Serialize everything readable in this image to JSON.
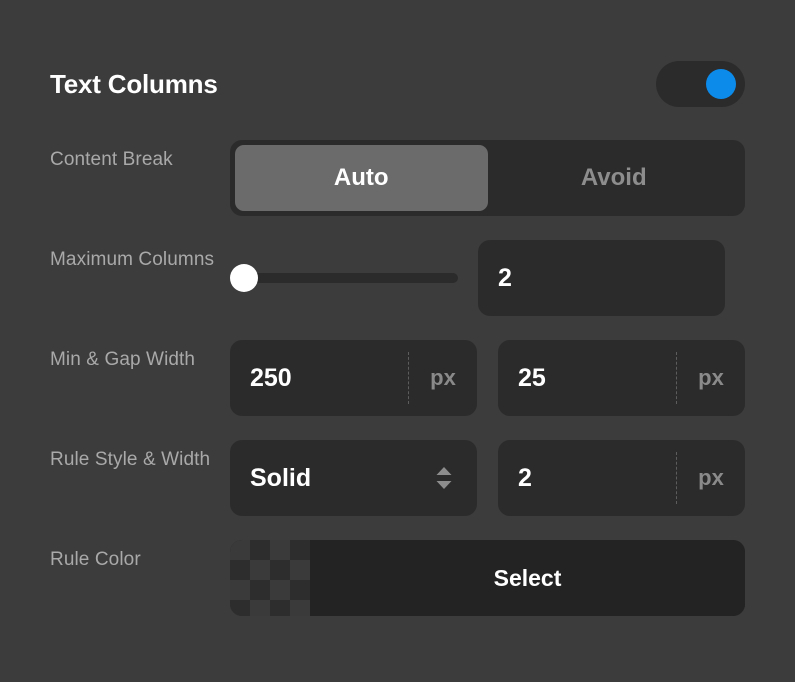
{
  "header": {
    "title": "Text Columns",
    "toggle": {
      "name": "text-columns-enabled",
      "state": "on",
      "accent_color": "#0d8bea"
    }
  },
  "rows": {
    "content_break": {
      "label": "Content Break",
      "segments": [
        {
          "label": "Auto",
          "selected": true
        },
        {
          "label": "Avoid",
          "selected": false
        }
      ]
    },
    "maximum_columns": {
      "label": "Maximum Columns",
      "slider_position_percent": 0,
      "value": "2"
    },
    "min_gap_width": {
      "label": "Min & Gap Width",
      "min_width": {
        "value": "250",
        "unit": "px"
      },
      "gap_width": {
        "value": "25",
        "unit": "px"
      }
    },
    "rule_style_width": {
      "label": "Rule Style & Width",
      "style": {
        "value": "Solid"
      },
      "width": {
        "value": "2",
        "unit": "px"
      }
    },
    "rule_color": {
      "label": "Rule Color",
      "swatch": "transparent-checkerboard",
      "select_label": "Select"
    }
  },
  "theme": {
    "background": "#3c3c3c",
    "field_background": "#2b2b2b",
    "selected_segment": "#6b6b6b",
    "label_color": "#a9a9a9",
    "value_color": "#ffffff",
    "unit_color": "#8a8a8a"
  }
}
